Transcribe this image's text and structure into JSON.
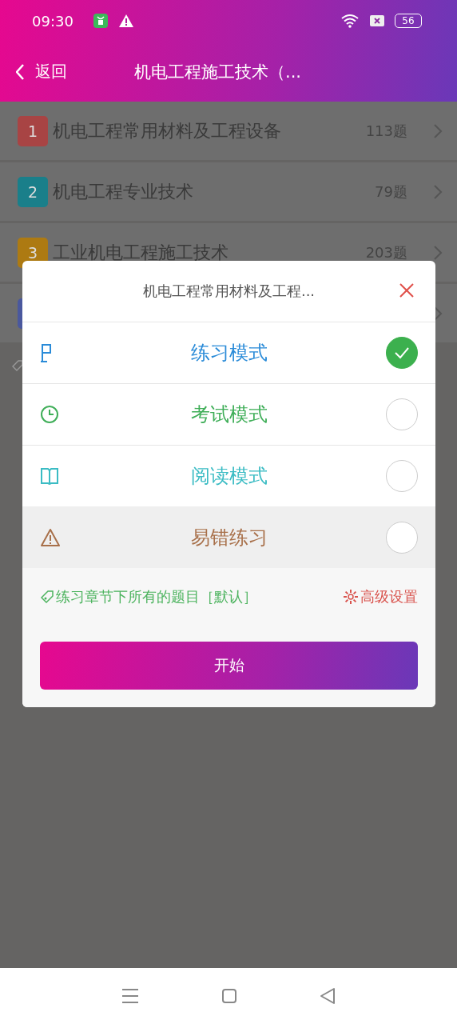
{
  "status_bar": {
    "time": "09:30",
    "battery": "56"
  },
  "header": {
    "back": "返回",
    "title": "机电工程施工技术（..."
  },
  "chapters": [
    {
      "number": "1",
      "title": "机电工程常用材料及工程设备",
      "count": "113题",
      "color": "#a84444"
    },
    {
      "number": "2",
      "title": "机电工程专业技术",
      "count": "79题",
      "color": "#1a7f8a"
    },
    {
      "number": "3",
      "title": "工业机电工程施工技术",
      "count": "203题",
      "color": "#ad7a12"
    },
    {
      "color": "#4a589e"
    }
  ],
  "dialog": {
    "title": "机电工程常用材料及工程...",
    "modes": [
      {
        "kind": "flag",
        "label": "练习模式",
        "color": "#2a8bd8",
        "selected": true,
        "highlighted": false
      },
      {
        "kind": "clock",
        "label": "考试模式",
        "color": "#3fae58",
        "selected": false,
        "highlighted": false
      },
      {
        "kind": "book",
        "label": "阅读模式",
        "color": "#3bbcc4",
        "selected": false,
        "highlighted": false
      },
      {
        "kind": "warning",
        "label": "易错练习",
        "color": "#a8704a",
        "selected": false,
        "highlighted": true
      }
    ],
    "scope": "练习章节下所有的题目［默认］",
    "settings": "高级设置",
    "start": "开始"
  }
}
